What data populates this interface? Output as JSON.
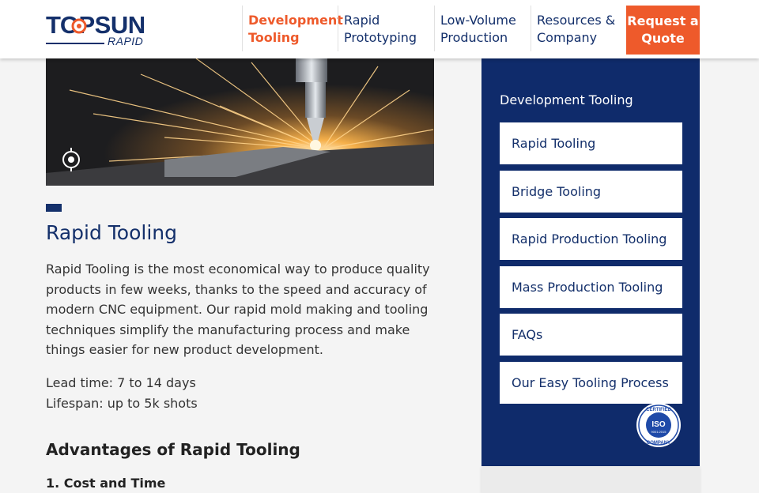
{
  "brand": {
    "name_top": "TOPSUN",
    "name_bottom": "RAPID",
    "primary_color": "#14306b",
    "accent_color": "#ee5a2b"
  },
  "nav": {
    "items": [
      {
        "label": "Development Tooling",
        "active": true
      },
      {
        "label": "Rapid Prototyping",
        "active": false
      },
      {
        "label": "Low-Volume Production",
        "active": false
      },
      {
        "label": "Resources & Company",
        "active": false
      }
    ],
    "cta_label": "Request a Quote"
  },
  "main": {
    "title": "Rapid Tooling",
    "description": "Rapid Tooling is the most economical way to produce quality products in few weeks, thanks to the speed and accuracy of modern CNC equipment. Our rapid mold making and tooling techniques simplify the manufacturing process and make things easier for new product development.",
    "lead_time": "Lead time: 7 to 14 days",
    "lifespan": "Lifespan: up to 5k shots",
    "advantages_heading": "Advantages of Rapid Tooling",
    "first_advantage": "1. Cost and Time"
  },
  "sidebar": {
    "heading": "Development Tooling",
    "items": [
      {
        "label": "Rapid Tooling"
      },
      {
        "label": "Bridge Tooling"
      },
      {
        "label": "Rapid Production Tooling"
      },
      {
        "label": "Mass Production Tooling"
      },
      {
        "label": "FAQs"
      },
      {
        "label": "Our Easy Tooling Process"
      }
    ],
    "badge": {
      "top": "CERTIFIED",
      "center": "ISO",
      "standard": "9001:2015",
      "bottom": "COMPANY"
    }
  },
  "icons": [
    "topsun-logo-icon",
    "camera-aperture-icon",
    "iso-certified-badge-icon"
  ]
}
